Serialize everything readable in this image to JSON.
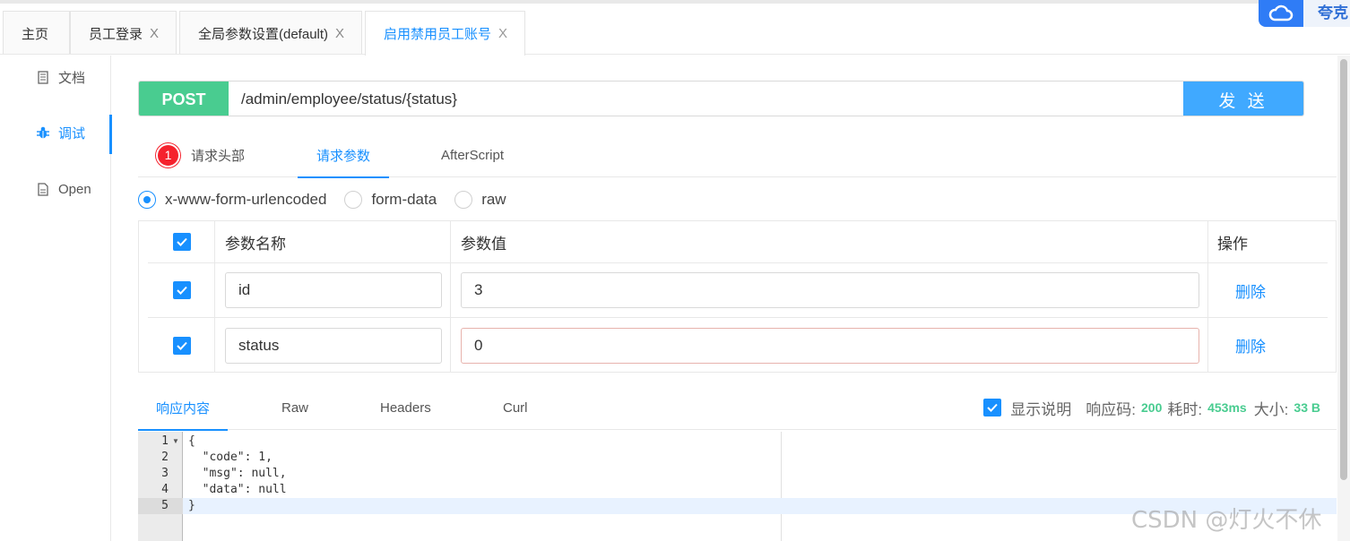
{
  "tabs": [
    {
      "label": "主页",
      "closable": false,
      "active": false
    },
    {
      "label": "员工登录",
      "closable": true,
      "active": false
    },
    {
      "label": "全局参数设置(default)",
      "closable": true,
      "active": false
    },
    {
      "label": "启用禁用员工账号",
      "closable": true,
      "active": true
    }
  ],
  "tab_close_glyph": "X",
  "corner": {
    "brand_text": "夸克"
  },
  "sidebar": {
    "items": [
      {
        "label": "文档",
        "icon": "document-icon",
        "active": false
      },
      {
        "label": "调试",
        "icon": "bug-icon",
        "active": true
      },
      {
        "label": "Open",
        "icon": "file-icon",
        "active": false
      }
    ]
  },
  "request": {
    "method": "POST",
    "url": "/admin/employee/status/{status}",
    "send_label": "发 送"
  },
  "subtabs": {
    "headers_badge": "1",
    "headers_label": "请求头部",
    "params_label": "请求参数",
    "afterscript_label": "AfterScript"
  },
  "content_types": [
    {
      "label": "x-www-form-urlencoded",
      "checked": true
    },
    {
      "label": "form-data",
      "checked": false
    },
    {
      "label": "raw",
      "checked": false
    }
  ],
  "params_table": {
    "headers": {
      "name": "参数名称",
      "value": "参数值",
      "ops": "操作"
    },
    "rows": [
      {
        "checked": true,
        "name": "id",
        "value": "3",
        "action": "删除"
      },
      {
        "checked": true,
        "name": "status",
        "value": "0",
        "action": "删除"
      }
    ]
  },
  "response": {
    "tabs": [
      "响应内容",
      "Raw",
      "Headers",
      "Curl"
    ],
    "show_desc_label": "显示说明",
    "code_label": "响应码:",
    "code_value": "200",
    "time_label": "耗时:",
    "time_value": "453ms",
    "size_label": "大小:",
    "size_value": "33 B",
    "line_numbers": [
      "1",
      "2",
      "3",
      "4",
      "5"
    ],
    "body_lines": [
      "{",
      "  \"code\": 1,",
      "  \"msg\": null,",
      "  \"data\": null",
      "}"
    ]
  },
  "watermark": "CSDN @灯火不休",
  "colors": {
    "accent": "#1890ff",
    "post_green": "#49cc90",
    "send_blue": "#40a9ff",
    "badge_red": "#f5222d"
  }
}
